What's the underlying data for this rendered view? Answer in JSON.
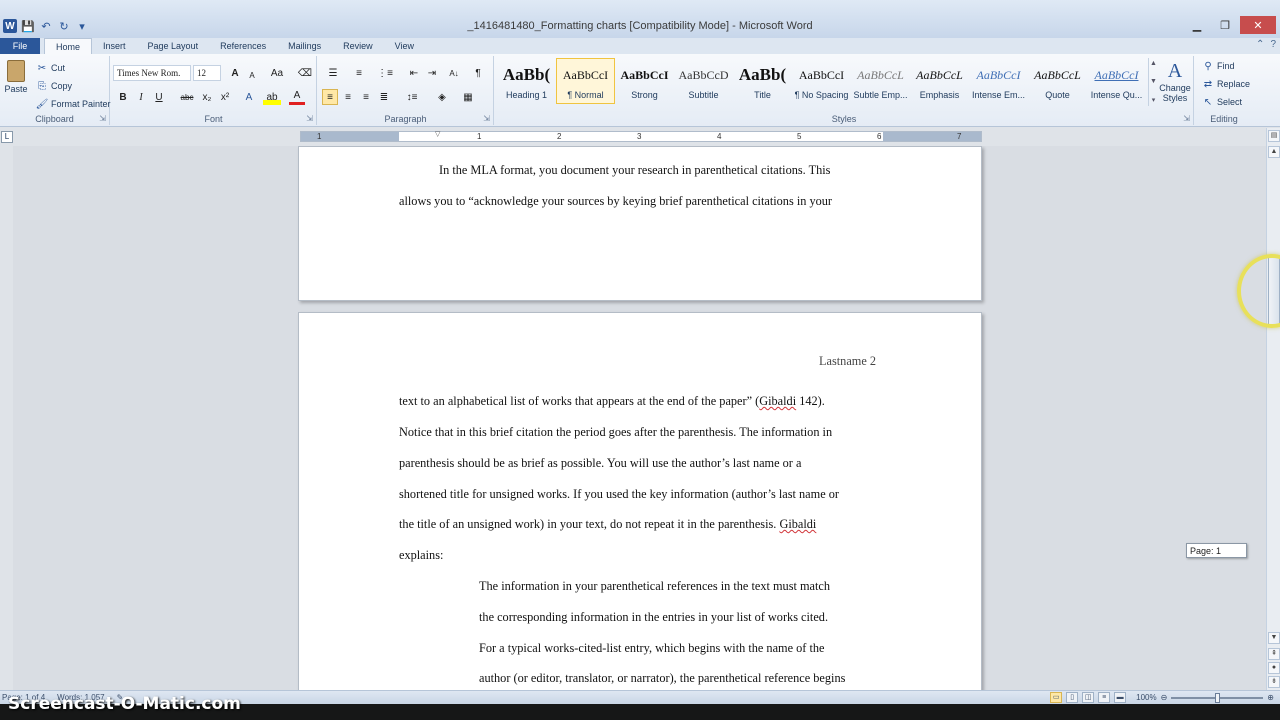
{
  "window": {
    "title": "_1416481480_Formatting charts [Compatibility Mode] - Microsoft Word",
    "app_icon_letter": "W",
    "controls": {
      "minimize": "▁",
      "maximize": "❐",
      "close": "✕"
    }
  },
  "tabs": [
    {
      "label": "File"
    },
    {
      "label": "Home"
    },
    {
      "label": "Insert"
    },
    {
      "label": "Page Layout"
    },
    {
      "label": "References"
    },
    {
      "label": "Mailings"
    },
    {
      "label": "Review"
    },
    {
      "label": "View"
    }
  ],
  "ribbon": {
    "clipboard": {
      "paste_label": "Paste",
      "cut_label": "Cut",
      "copy_label": "Copy",
      "format_painter_label": "Format Painter",
      "group_label": "Clipboard"
    },
    "font": {
      "font_name": "Times New Rom.",
      "font_size": "12",
      "bold": "B",
      "italic": "I",
      "underline": "U",
      "strikethrough": "abc",
      "subscript": "x₂",
      "superscript": "x²",
      "grow": "A",
      "shrink": "A",
      "change_case": "Aa",
      "font_color": "A",
      "highlight": "ab",
      "group_label": "Font"
    },
    "paragraph": {
      "group_label": "Paragraph",
      "pilcrow": "¶",
      "sort": "A↓"
    },
    "styles": {
      "group_label": "Styles",
      "items": [
        {
          "preview": "AaBb(",
          "name": "Heading 1"
        },
        {
          "preview": "AaBbCcI",
          "name": "¶ Normal"
        },
        {
          "preview": "AaBbCcI",
          "name": "Strong"
        },
        {
          "preview": "AaBbCcD",
          "name": "Subtitle"
        },
        {
          "preview": "AaBb(",
          "name": "Title"
        },
        {
          "preview": "AaBbCcI",
          "name": "¶ No Spacing"
        },
        {
          "preview": "AaBbCcL",
          "name": "Subtle Emp..."
        },
        {
          "preview": "AaBbCcL",
          "name": "Emphasis"
        },
        {
          "preview": "AaBbCcI",
          "name": "Intense Em..."
        },
        {
          "preview": "AaBbCcL",
          "name": "Quote"
        },
        {
          "preview": "AaBbCcI",
          "name": "Intense Qu..."
        }
      ],
      "change_styles_label": "Change Styles"
    },
    "editing": {
      "group_label": "Editing",
      "find_label": "Find",
      "replace_label": "Replace",
      "select_label": "Select"
    }
  },
  "ruler": {
    "numbers": [
      "1",
      "1",
      "2",
      "3",
      "4",
      "5",
      "6",
      "7"
    ]
  },
  "document": {
    "page1_lines": [
      "In the MLA format, you document your research in parenthetical citations. This",
      "allows you to “acknowledge your sources by keying brief parenthetical citations in your"
    ],
    "header_text": "Lastname 2",
    "page2_lines": [
      "text to an alphabetical list of works that appears at the end of the paper” (",
      "Notice that in this brief citation the period goes after the parenthesis. The information in",
      "parenthesis should be as brief as possible. You will use the author’s last name or a",
      "shortened title for unsigned works. If you used the key information (author’s last name or",
      "the title of an unsigned work) in your text, do not repeat it in the parenthesis. ",
      "explains:"
    ],
    "citation_name": "Gibaldi",
    "citation_page": " 142).",
    "block_quote_lines": [
      "The information in your parenthetical references in the text must match",
      "the corresponding information in the entries in your list of works cited.",
      "For a typical works-cited-list entry, which begins with the name of the",
      "author (or editor, translator, or narrator), the parenthetical reference begins"
    ]
  },
  "scrollbar": {
    "page_tooltip": "Page: 1"
  },
  "statusbar": {
    "page_info": "Page: 1 of 4",
    "words": "Words: 1,057",
    "zoom": "100%"
  },
  "watermark": "Screencast-O-Matic.com"
}
